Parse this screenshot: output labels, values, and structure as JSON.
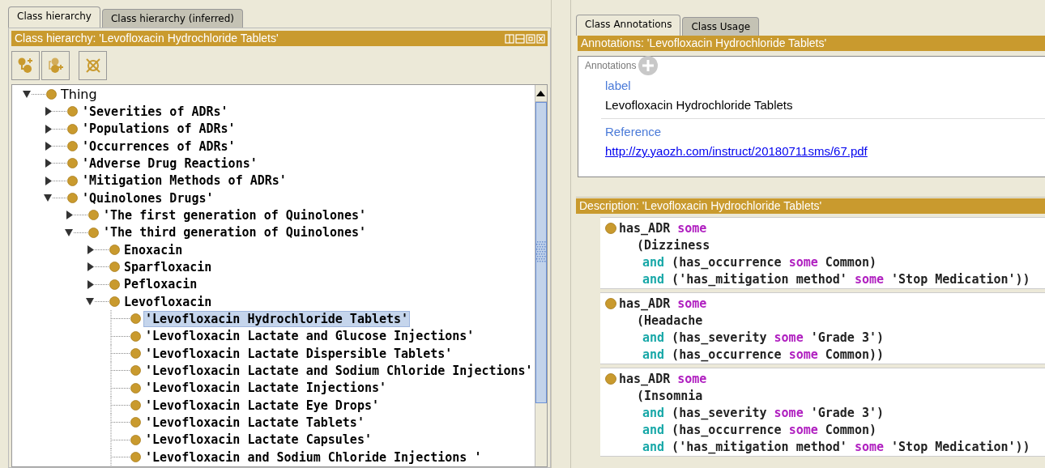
{
  "left": {
    "tabs": [
      {
        "label": "Class hierarchy",
        "selected": true
      },
      {
        "label": "Class hierarchy (inferred)",
        "selected": false
      }
    ],
    "header": "Class hierarchy: 'Levofloxacin Hydrochloride Tablets'",
    "tree": [
      {
        "label": "Thing",
        "kind": "branch",
        "expanded": true,
        "selected": false,
        "children": [
          {
            "label": "'Severities of ADRs'",
            "kind": "branch",
            "expanded": false,
            "selected": false
          },
          {
            "label": "'Populations of ADRs'",
            "kind": "branch",
            "expanded": false,
            "selected": false
          },
          {
            "label": "'Occurrences of ADRs'",
            "kind": "branch",
            "expanded": false,
            "selected": false
          },
          {
            "label": "'Adverse Drug Reactions'",
            "kind": "branch",
            "expanded": false,
            "selected": false
          },
          {
            "label": "'Mitigation Methods of ADRs'",
            "kind": "branch",
            "expanded": false,
            "selected": false
          },
          {
            "label": "'Quinolones Drugs'",
            "kind": "branch",
            "expanded": true,
            "selected": false,
            "children": [
              {
                "label": "'The first generation of Quinolones'",
                "kind": "branch",
                "expanded": false,
                "selected": false
              },
              {
                "label": "'The third generation of Quinolones'",
                "kind": "branch",
                "expanded": true,
                "selected": false,
                "children": [
                  {
                    "label": "Enoxacin",
                    "kind": "branch",
                    "expanded": false,
                    "selected": false
                  },
                  {
                    "label": "Sparfloxacin",
                    "kind": "branch",
                    "expanded": false,
                    "selected": false
                  },
                  {
                    "label": "Pefloxacin",
                    "kind": "branch",
                    "expanded": false,
                    "selected": false
                  },
                  {
                    "label": "Levofloxacin",
                    "kind": "branch",
                    "expanded": true,
                    "selected": false,
                    "children": [
                      {
                        "label": "'Levofloxacin Hydrochloride Tablets'",
                        "kind": "leaf",
                        "selected": true
                      },
                      {
                        "label": "'Levofloxacin Lactate and Glucose Injections'",
                        "kind": "leaf",
                        "selected": false
                      },
                      {
                        "label": "'Levofloxacin Lactate Dispersible Tablets'",
                        "kind": "leaf",
                        "selected": false
                      },
                      {
                        "label": "'Levofloxacin Lactate and Sodium Chloride Injections'",
                        "kind": "leaf",
                        "selected": false
                      },
                      {
                        "label": "'Levofloxacin Lactate Injections'",
                        "kind": "leaf",
                        "selected": false
                      },
                      {
                        "label": "'Levofloxacin Lactate Eye Drops'",
                        "kind": "leaf",
                        "selected": false
                      },
                      {
                        "label": "'Levofloxacin Lactate Tablets'",
                        "kind": "leaf",
                        "selected": false
                      },
                      {
                        "label": "'Levofloxacin Lactate Capsules'",
                        "kind": "leaf",
                        "selected": false
                      },
                      {
                        "label": "'Levofloxacin and Sodium Chloride Injections '",
                        "kind": "leaf",
                        "selected": false
                      }
                    ]
                  }
                ]
              }
            ]
          }
        ]
      }
    ]
  },
  "right": {
    "tabs": [
      {
        "label": "Class Annotations",
        "selected": true
      },
      {
        "label": "Class Usage",
        "selected": false
      }
    ],
    "annotations_header": "Annotations: 'Levofloxacin Hydrochloride Tablets'",
    "annotations_label": "Annotations",
    "annotations": [
      {
        "property": "label",
        "value": "Levofloxacin Hydrochloride Tablets",
        "kind": "text"
      },
      {
        "property": "Reference",
        "value": "http://zy.yaozh.com/instruct/20180711sms/67.pdf",
        "kind": "link"
      }
    ],
    "description_header": "Description: 'Levofloxacin Hydrochloride Tablets'",
    "description": [
      {
        "lines": [
          {
            "kind": "head",
            "tokens": [
              {
                "text": "has_ADR ",
                "kind": "plain"
              },
              {
                "text": "some",
                "kind": "keyword"
              }
            ]
          },
          {
            "kind": "filler",
            "tokens": [
              {
                "text": "(Dizziness",
                "kind": "plain"
              }
            ]
          },
          {
            "kind": "conjunct",
            "tokens": [
              {
                "text": "and",
                "kind": "connective"
              },
              {
                "text": " (has_occurrence ",
                "kind": "plain"
              },
              {
                "text": "some",
                "kind": "keyword"
              },
              {
                "text": " Common)",
                "kind": "plain"
              }
            ]
          },
          {
            "kind": "conjunct",
            "tokens": [
              {
                "text": "and",
                "kind": "connective"
              },
              {
                "text": " ('has_mitigation method' ",
                "kind": "plain"
              },
              {
                "text": "some",
                "kind": "keyword"
              },
              {
                "text": " 'Stop Medication'))",
                "kind": "plain"
              }
            ]
          }
        ]
      },
      {
        "lines": [
          {
            "kind": "head",
            "tokens": [
              {
                "text": "has_ADR ",
                "kind": "plain"
              },
              {
                "text": "some",
                "kind": "keyword"
              }
            ]
          },
          {
            "kind": "filler",
            "tokens": [
              {
                "text": "(Headache",
                "kind": "plain"
              }
            ]
          },
          {
            "kind": "conjunct",
            "tokens": [
              {
                "text": "and",
                "kind": "connective"
              },
              {
                "text": " (has_severity ",
                "kind": "plain"
              },
              {
                "text": "some",
                "kind": "keyword"
              },
              {
                "text": " 'Grade 3')",
                "kind": "plain"
              }
            ]
          },
          {
            "kind": "conjunct",
            "tokens": [
              {
                "text": "and",
                "kind": "connective"
              },
              {
                "text": " (has_occurrence ",
                "kind": "plain"
              },
              {
                "text": "some",
                "kind": "keyword"
              },
              {
                "text": " Common))",
                "kind": "plain"
              }
            ]
          }
        ]
      },
      {
        "lines": [
          {
            "kind": "head",
            "tokens": [
              {
                "text": "has_ADR ",
                "kind": "plain"
              },
              {
                "text": "some",
                "kind": "keyword"
              }
            ]
          },
          {
            "kind": "filler",
            "tokens": [
              {
                "text": "(Insomnia",
                "kind": "plain"
              }
            ]
          },
          {
            "kind": "conjunct",
            "tokens": [
              {
                "text": "and",
                "kind": "connective"
              },
              {
                "text": " (has_severity ",
                "kind": "plain"
              },
              {
                "text": "some",
                "kind": "keyword"
              },
              {
                "text": " 'Grade 3')",
                "kind": "plain"
              }
            ]
          },
          {
            "kind": "conjunct",
            "tokens": [
              {
                "text": "and",
                "kind": "connective"
              },
              {
                "text": " (has_occurrence ",
                "kind": "plain"
              },
              {
                "text": "some",
                "kind": "keyword"
              },
              {
                "text": " Common)",
                "kind": "plain"
              }
            ]
          },
          {
            "kind": "conjunct",
            "tokens": [
              {
                "text": "and",
                "kind": "connective"
              },
              {
                "text": " ('has_mitigation method' ",
                "kind": "plain"
              },
              {
                "text": "some",
                "kind": "keyword"
              },
              {
                "text": " 'Stop Medication'))",
                "kind": "plain"
              }
            ]
          }
        ]
      }
    ]
  }
}
